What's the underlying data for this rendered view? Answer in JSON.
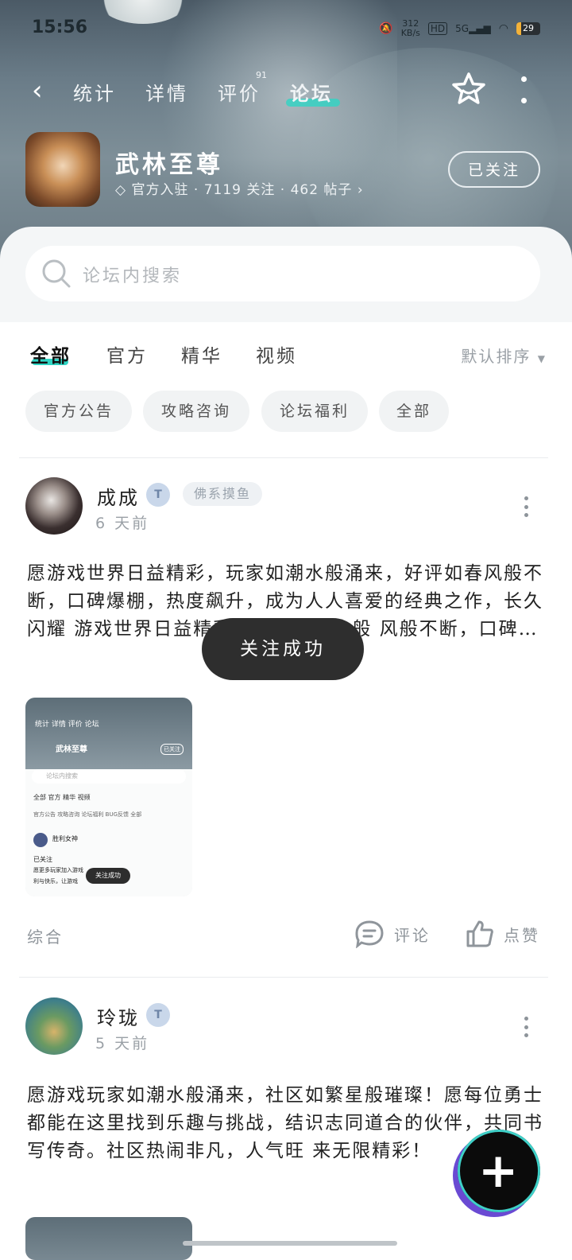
{
  "status_bar": {
    "time": "15:56",
    "net_speed": "312",
    "net_unit": "KB/s",
    "hd": "HD",
    "signal": "5G",
    "battery": "29"
  },
  "nav": {
    "tabs": [
      {
        "label": "统计"
      },
      {
        "label": "详情"
      },
      {
        "label": "评价",
        "badge": "91"
      },
      {
        "label": "论坛"
      }
    ],
    "active_tab": "论坛"
  },
  "game": {
    "name": "武林至尊",
    "meta": "官方入驻 · 7119 关注 · 462 帖子",
    "follow_label": "已关注"
  },
  "search": {
    "placeholder": "论坛内搜索"
  },
  "filter_tabs": [
    "全部",
    "官方",
    "精华",
    "视频"
  ],
  "sort_label": "默认排序",
  "chips": [
    "官方公告",
    "攻略咨询",
    "论坛福利",
    "全部"
  ],
  "posts": [
    {
      "username": "成成",
      "level": "T",
      "tag": "佛系摸鱼",
      "time": "6 天前",
      "text": "愿游戏世界日益精彩，玩家如潮水般涌来，好评如春风般不断，口碑爆棚，热度飙升，成为人人喜爱的经典之作，长久闪耀  游戏世界日益精彩，玩家如潮水般 风般不断，口碑…",
      "category": "综合",
      "comment_label": "评论",
      "like_label": "点赞"
    },
    {
      "username": "玲珑",
      "level": "T",
      "time": "5 天前",
      "text": "愿游戏玩家如潮水般涌来，社区如繁星般璀璨！愿每位勇士都能在这里找到乐趣与挑战，结识志同道合的伙伴，共同书写传奇。社区热闹非凡，人气旺 来无限精彩！"
    }
  ],
  "thumb": {
    "tabs": "统计 详情 评价 论坛",
    "name": "武林至尊",
    "follow": "已关注",
    "search": "论坛内搜索",
    "filters": "全部 官方 精华 视频",
    "chips": "官方公告 攻略咨询 论坛福利 BUG反馈 全部",
    "user": "胜利女神",
    "line1": "已关注",
    "line2": "愿更多玩家加入游戏",
    "line3": "利与快乐，让游戏",
    "toast": "关注成功"
  },
  "toast": "关注成功",
  "fab_label": "+"
}
